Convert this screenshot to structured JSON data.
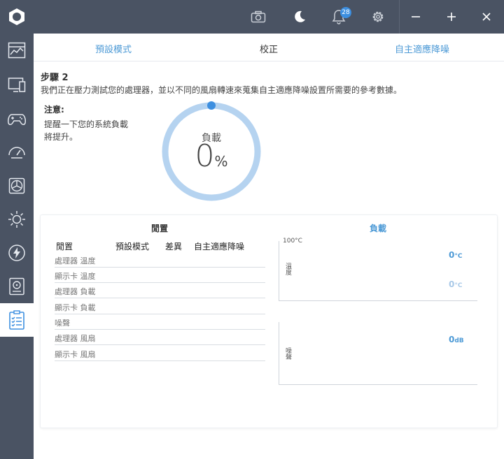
{
  "titlebar": {
    "notification_count": "28",
    "icons": [
      "app-logo-icon",
      "camera-icon",
      "moon-icon",
      "bell-icon",
      "gear-icon",
      "minimize-icon",
      "maximize-icon",
      "close-icon"
    ]
  },
  "sidebar": {
    "items": [
      {
        "name": "dashboard-icon"
      },
      {
        "name": "monitor-icon"
      },
      {
        "name": "gamepad-icon"
      },
      {
        "name": "speedometer-icon"
      },
      {
        "name": "fan-icon"
      },
      {
        "name": "brightness-icon"
      },
      {
        "name": "lightning-icon"
      },
      {
        "name": "storage-icon"
      },
      {
        "name": "checklist-icon",
        "active": true
      }
    ]
  },
  "tabs": [
    "預設模式",
    "校正",
    "自主適應降噪"
  ],
  "step": {
    "title": "步驟 2",
    "description": "我們正在壓力測試您的處理器，並以不同的風扇轉速來蒐集自主適應降噪設置所需要的參考數據。"
  },
  "note": {
    "title": "注意:",
    "body": "提醒一下您的系統負載將提升。"
  },
  "gauge": {
    "label": "負載",
    "value": "0",
    "unit": "%",
    "percent": 0
  },
  "settings": {
    "section_title": "閒置",
    "columns": [
      "閒置",
      "預設模式",
      "差異",
      "自主適應降噪"
    ],
    "rows": [
      "處理器 溫度",
      "顯示卡 溫度",
      "處理器 負載",
      "顯示卡 負載",
      "噪聲",
      "處理器 風扇",
      "顯示卡 風扇"
    ]
  },
  "load": {
    "section_title": "負載",
    "temp_chart": {
      "axis_max": "100°C",
      "axis_label": "溫度",
      "reading_1": "0",
      "reading_2": "0",
      "unit": "°C"
    },
    "noise_chart": {
      "axis_label": "噪聲",
      "reading": "0",
      "unit": "dB"
    }
  },
  "colors": {
    "sidebar": "#4a5363",
    "accent": "#4d9ad6",
    "gauge_ring": "#b5d3f0",
    "gauge_dot": "#3d8fe0",
    "reading_light": "#a9c9e8"
  }
}
